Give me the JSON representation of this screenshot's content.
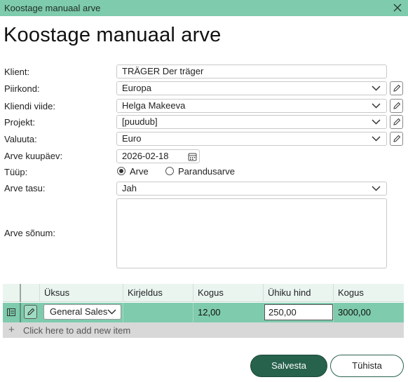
{
  "window": {
    "title": "Koostage manuaal arve"
  },
  "heading": "Koostage manuaal arve",
  "form": {
    "client": {
      "label": "Klient:",
      "value": "TRÄGER Der träger"
    },
    "region": {
      "label": "Piirkond:",
      "value": "Europa"
    },
    "client_ref": {
      "label": "Kliendi viide:",
      "value": "Helga Makeeva"
    },
    "project": {
      "label": "Projekt:",
      "value": "[puudub]"
    },
    "currency": {
      "label": "Valuuta:",
      "value": "Euro"
    },
    "invoice_date": {
      "label": "Arve kuupäev:",
      "value": "2026-02-18"
    },
    "type": {
      "label": "Tüüp:",
      "options": [
        "Arve",
        "Parandusarve"
      ],
      "selected": "Arve"
    },
    "invoice_fee": {
      "label": "Arve tasu:",
      "value": "Jah"
    },
    "invoice_message": {
      "label": "Arve sõnum:",
      "value": ""
    }
  },
  "grid": {
    "columns": [
      "Üksus",
      "Kirjeldus",
      "Kogus",
      "Ühiku hind",
      "Kogus"
    ],
    "rows": [
      {
        "unit": "General Sales",
        "description": "",
        "quantity": "12,00",
        "unit_price": "250,00",
        "total": "3000,00"
      }
    ],
    "add_item": "Click here to add new item"
  },
  "buttons": {
    "save": "Salvesta",
    "cancel": "Tühista"
  },
  "colors": {
    "accent": "#7ecbad",
    "primary_button": "#27624c",
    "header_row": "#eaf5f0"
  }
}
